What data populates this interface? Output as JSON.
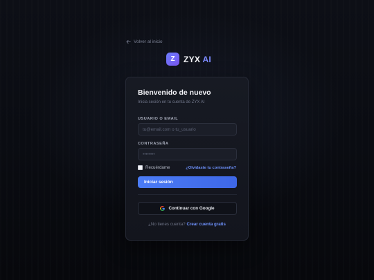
{
  "back_link": {
    "label": "Volver al inicio",
    "icon": "arrow-left-icon"
  },
  "brand": {
    "badge_letter": "Z",
    "name": "ZYX",
    "suffix": "AI",
    "accent": "#7d8bff"
  },
  "login": {
    "title": "Bienvenido de nuevo",
    "subtitle": "Inicia sesión en tu cuenta de ZYX AI",
    "username_label": "USUARIO O EMAIL",
    "username_placeholder": "tu@email.com o tu_usuario",
    "username_value": "",
    "password_label": "CONTRASEÑA",
    "password_placeholder": "••••••••",
    "password_value": "",
    "remember_label": "Recuérdame",
    "remember_checked": false,
    "forgot_label": "¿Olvidaste tu contraseña?",
    "submit_label": "Iniciar sesión",
    "google_label": "Continuar con Google",
    "google_icon": "google-icon",
    "no_account_text": "¿No tienes cuenta?",
    "signup_link": "Crear cuenta gratis"
  },
  "colors": {
    "primary": "#4b7cf6",
    "link": "#6f93ff",
    "background": "#0b0d13",
    "card": "#161922"
  }
}
